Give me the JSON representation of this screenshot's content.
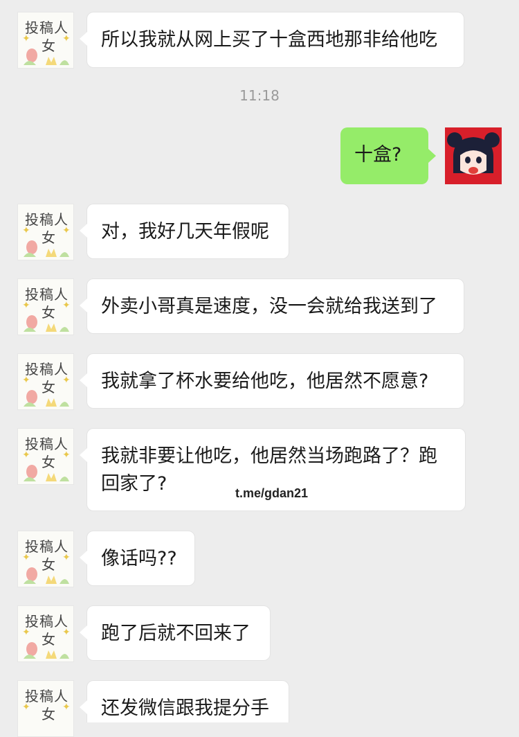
{
  "messages": [
    {
      "side": "left",
      "text": "所以我就从网上买了十盒西地那非给他吃"
    },
    {
      "side": "right",
      "text": "十盒?"
    },
    {
      "side": "left",
      "text": "对，我好几天年假呢"
    },
    {
      "side": "left",
      "text": "外卖小哥真是速度，没一会就给我送到了"
    },
    {
      "side": "left",
      "text": "我就拿了杯水要给他吃，他居然不愿意?"
    },
    {
      "side": "left",
      "text": "我就非要让他吃，他居然当场跑路了？跑回家了?"
    },
    {
      "side": "left",
      "text": "像话吗??"
    },
    {
      "side": "left",
      "text": "跑了后就不回来了"
    },
    {
      "side": "left",
      "text": "还发微信跟我提分手"
    }
  ],
  "timestamp": "11:18",
  "watermark": "t.me/gdan21",
  "left_avatar": {
    "line1": "投稿人",
    "line2": "女"
  },
  "colors": {
    "background": "#ededed",
    "sent_bubble": "#95ec69",
    "received_bubble": "#ffffff",
    "timestamp": "#9a9a9a",
    "right_avatar_bg": "#d81f2a"
  }
}
